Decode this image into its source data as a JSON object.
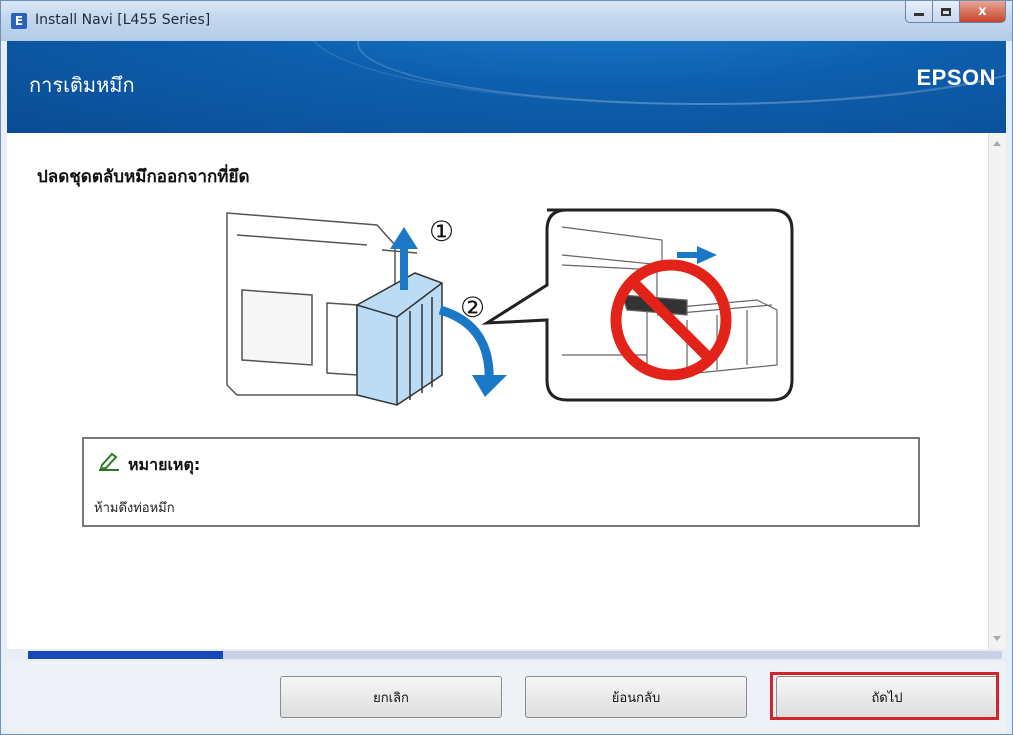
{
  "window": {
    "title": "Install Navi [L455 Series]",
    "app_icon_letter": "E",
    "close_glyph": "x"
  },
  "header": {
    "title": "การเติมหมึก",
    "brand": "EPSON"
  },
  "content": {
    "instruction": "ปลดชุดตลับหมึกออกจากที่ยึด",
    "step_markers": [
      "①",
      "②"
    ],
    "note": {
      "title": "หมายเหตุ:",
      "text": "ห้ามดึงท่อหมึก"
    }
  },
  "progress": {
    "fraction": 0.2
  },
  "buttons": {
    "cancel": "ยกเลิก",
    "back": "ย้อนกลับ",
    "next": "ถัดไป"
  },
  "colors": {
    "header_blue": "#0d5fae",
    "progress_fill": "#1747b8",
    "highlight_red": "#d0262b",
    "prohibit_red": "#e32219",
    "ink_tank_blue": "#bcdcf5"
  },
  "icons": [
    "epson-app-icon",
    "minimize-icon",
    "maximize-icon",
    "close-icon",
    "pencil-icon",
    "prohibit-icon",
    "arrow-up-icon",
    "arrow-curve-icon",
    "arrow-right-icon"
  ]
}
